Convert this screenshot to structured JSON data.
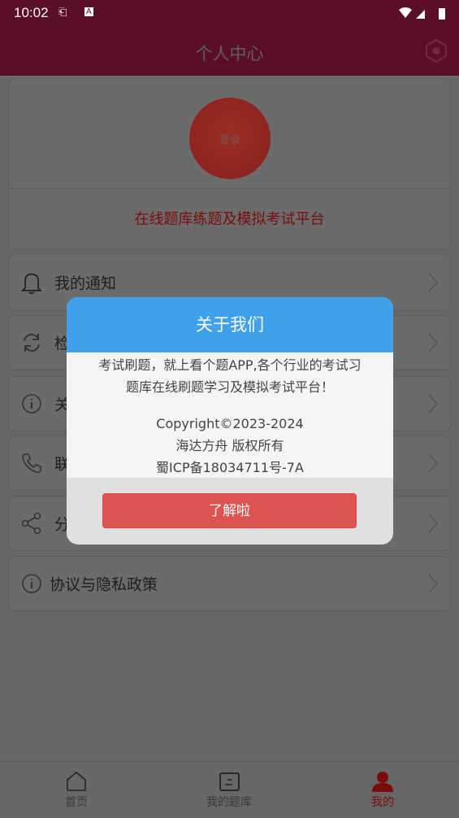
{
  "status_bar": {
    "time": "10:02"
  },
  "header": {
    "title": "个人中心",
    "settings_icon": "hexagon-settings-icon"
  },
  "profile": {
    "login_label": "登录",
    "slogan": "在线题库练题及模拟考试平台"
  },
  "menu": [
    {
      "label": "我的通知",
      "icon": "bell-icon"
    },
    {
      "label": "检",
      "icon": "refresh-icon"
    },
    {
      "label": "关",
      "icon": "info-icon"
    },
    {
      "label": "联",
      "icon": "phone-icon"
    },
    {
      "label": "分",
      "icon": "share-icon"
    },
    {
      "label": "协议与隐私政策",
      "icon": "info-icon"
    }
  ],
  "tabs": [
    {
      "label": "首页",
      "icon": "home-icon"
    },
    {
      "label": "我的题库",
      "icon": "question-bank-icon"
    },
    {
      "label": "我的",
      "icon": "user-icon",
      "active": true
    }
  ],
  "dialog": {
    "title": "关于我们",
    "line1": "考试刷题，就上看个题APP,各个行业的考试习",
    "line2": "题库在线刷题学习及模拟考试平台！",
    "copyright": "Copyright©2023-2024",
    "owner": "海达方舟 版权所有",
    "icp": "蜀ICP备18034711号-7A",
    "confirm": "了解啦"
  },
  "colors": {
    "header": "#5c0d29",
    "dialog_header": "#3fa0ec",
    "confirm_button": "#dc5350",
    "active_tab": "#7a0c0c"
  }
}
